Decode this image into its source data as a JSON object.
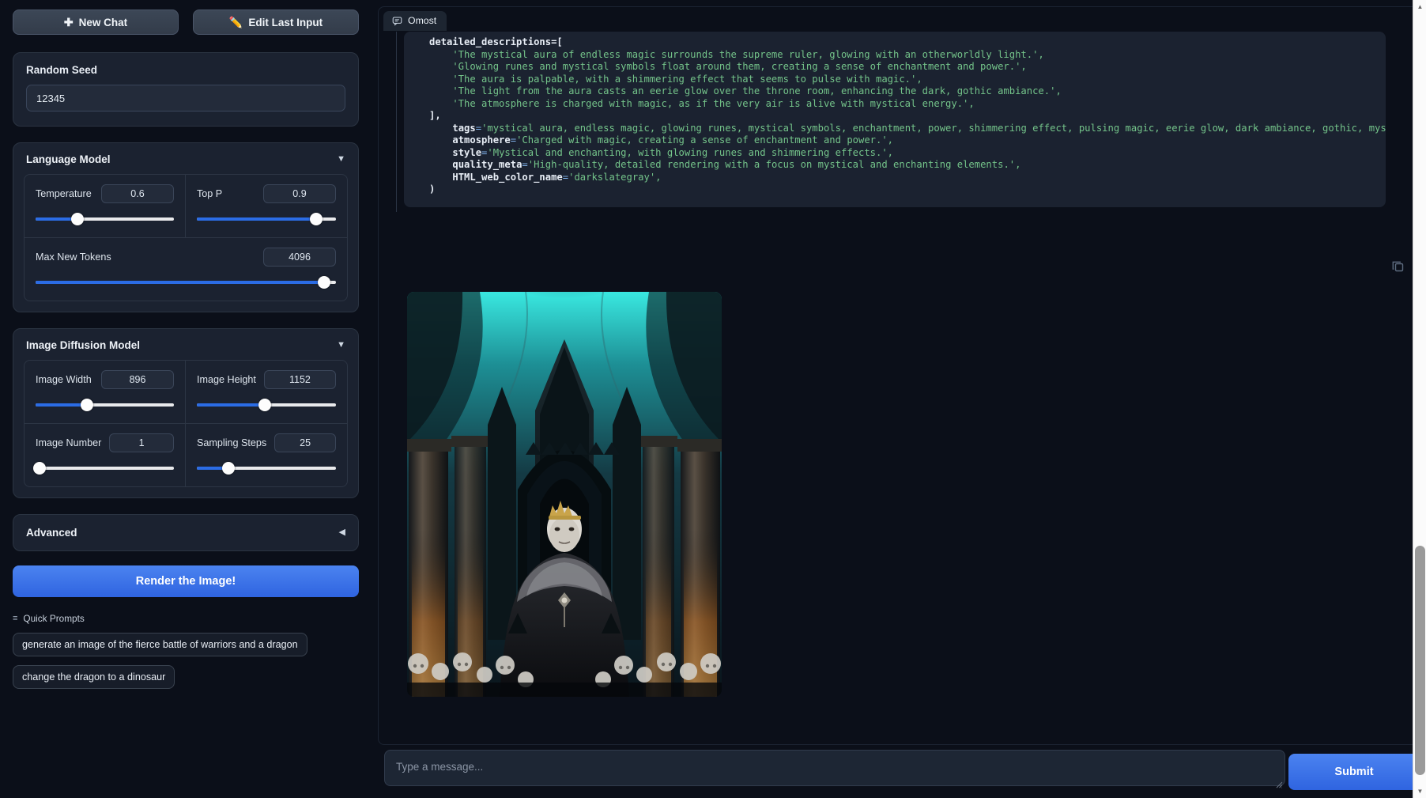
{
  "toolbar": {
    "new_chat_label": "New Chat",
    "new_chat_icon": "plus-icon",
    "edit_last_input_label": "Edit Last Input",
    "edit_last_input_icon": "pencil-icon"
  },
  "seed": {
    "label": "Random Seed",
    "value": "12345"
  },
  "language_model": {
    "title": "Language Model",
    "caret": "▼",
    "params": [
      {
        "label": "Temperature",
        "value": "0.6",
        "fill_pct": 30
      },
      {
        "label": "Top P",
        "value": "0.9",
        "fill_pct": 86
      },
      {
        "label": "Max New Tokens",
        "value": "4096",
        "fill_pct": 96
      }
    ]
  },
  "image_diffusion_model": {
    "title": "Image Diffusion Model",
    "caret": "▼",
    "params": [
      {
        "label": "Image Width",
        "value": "896",
        "fill_pct": 37
      },
      {
        "label": "Image Height",
        "value": "1152",
        "fill_pct": 49
      },
      {
        "label": "Image Number",
        "value": "1",
        "fill_pct": 2
      },
      {
        "label": "Sampling Steps",
        "value": "25",
        "fill_pct": 23
      }
    ]
  },
  "advanced": {
    "title": "Advanced",
    "caret": "◀"
  },
  "render_button": {
    "label": "Render the Image!"
  },
  "quick_prompts": {
    "heading": "Quick Prompts",
    "icon": "list-icon",
    "items": [
      "generate an image of the fierce battle of warriors and a dragon",
      "change the dragon to a dinosaur"
    ]
  },
  "chat": {
    "tab_label": "Omost",
    "tab_icon": "chat-bubble-icon",
    "copy_icon": "copy-icon",
    "code": {
      "line_01": "detailed_descriptions=[",
      "line_02": "    'The mystical aura of endless magic surrounds the supreme ruler, glowing with an otherworldly light.',",
      "line_03": "    'Glowing runes and mystical symbols float around them, creating a sense of enchantment and power.',",
      "line_04": "    'The aura is palpable, with a shimmering effect that seems to pulse with magic.',",
      "line_05": "    'The light from the aura casts an eerie glow over the throne room, enhancing the dark, gothic ambiance.',",
      "line_06": "    'The atmosphere is charged with magic, as if the very air is alive with mystical energy.',",
      "line_07": "],",
      "line_08_key": "tags",
      "line_08_val": "'mystical aura, endless magic, glowing runes, mystical symbols, enchantment, power, shimmering effect, pulsing magic, eerie glow, dark ambiance, gothic, mystical energy, otherworldly light, charged atmosphere',",
      "line_09_key": "atmosphere",
      "line_09_val": "'Charged with magic, creating a sense of enchantment and power.',",
      "line_10_key": "style",
      "line_10_val": "'Mystical and enchanting, with glowing runes and shimmering effects.',",
      "line_11_key": "quality_meta",
      "line_11_val": "'High-quality, detailed rendering with a focus on mystical and enchanting elements.',",
      "line_12_key": "HTML_web_color_name",
      "line_12_val": "'darkslategray',",
      "line_13": ")"
    },
    "generated_image_alt": "dark gothic throne room with a pale crowned ruler on a throne surrounded by skulls"
  },
  "composer": {
    "placeholder": "Type a message...",
    "value": "",
    "submit_label": "Submit"
  },
  "colors": {
    "accent_blue": "#2f64e0",
    "panel_bg": "#1b2230",
    "page_bg": "#0b0f19",
    "code_string_green": "#74c48a"
  }
}
